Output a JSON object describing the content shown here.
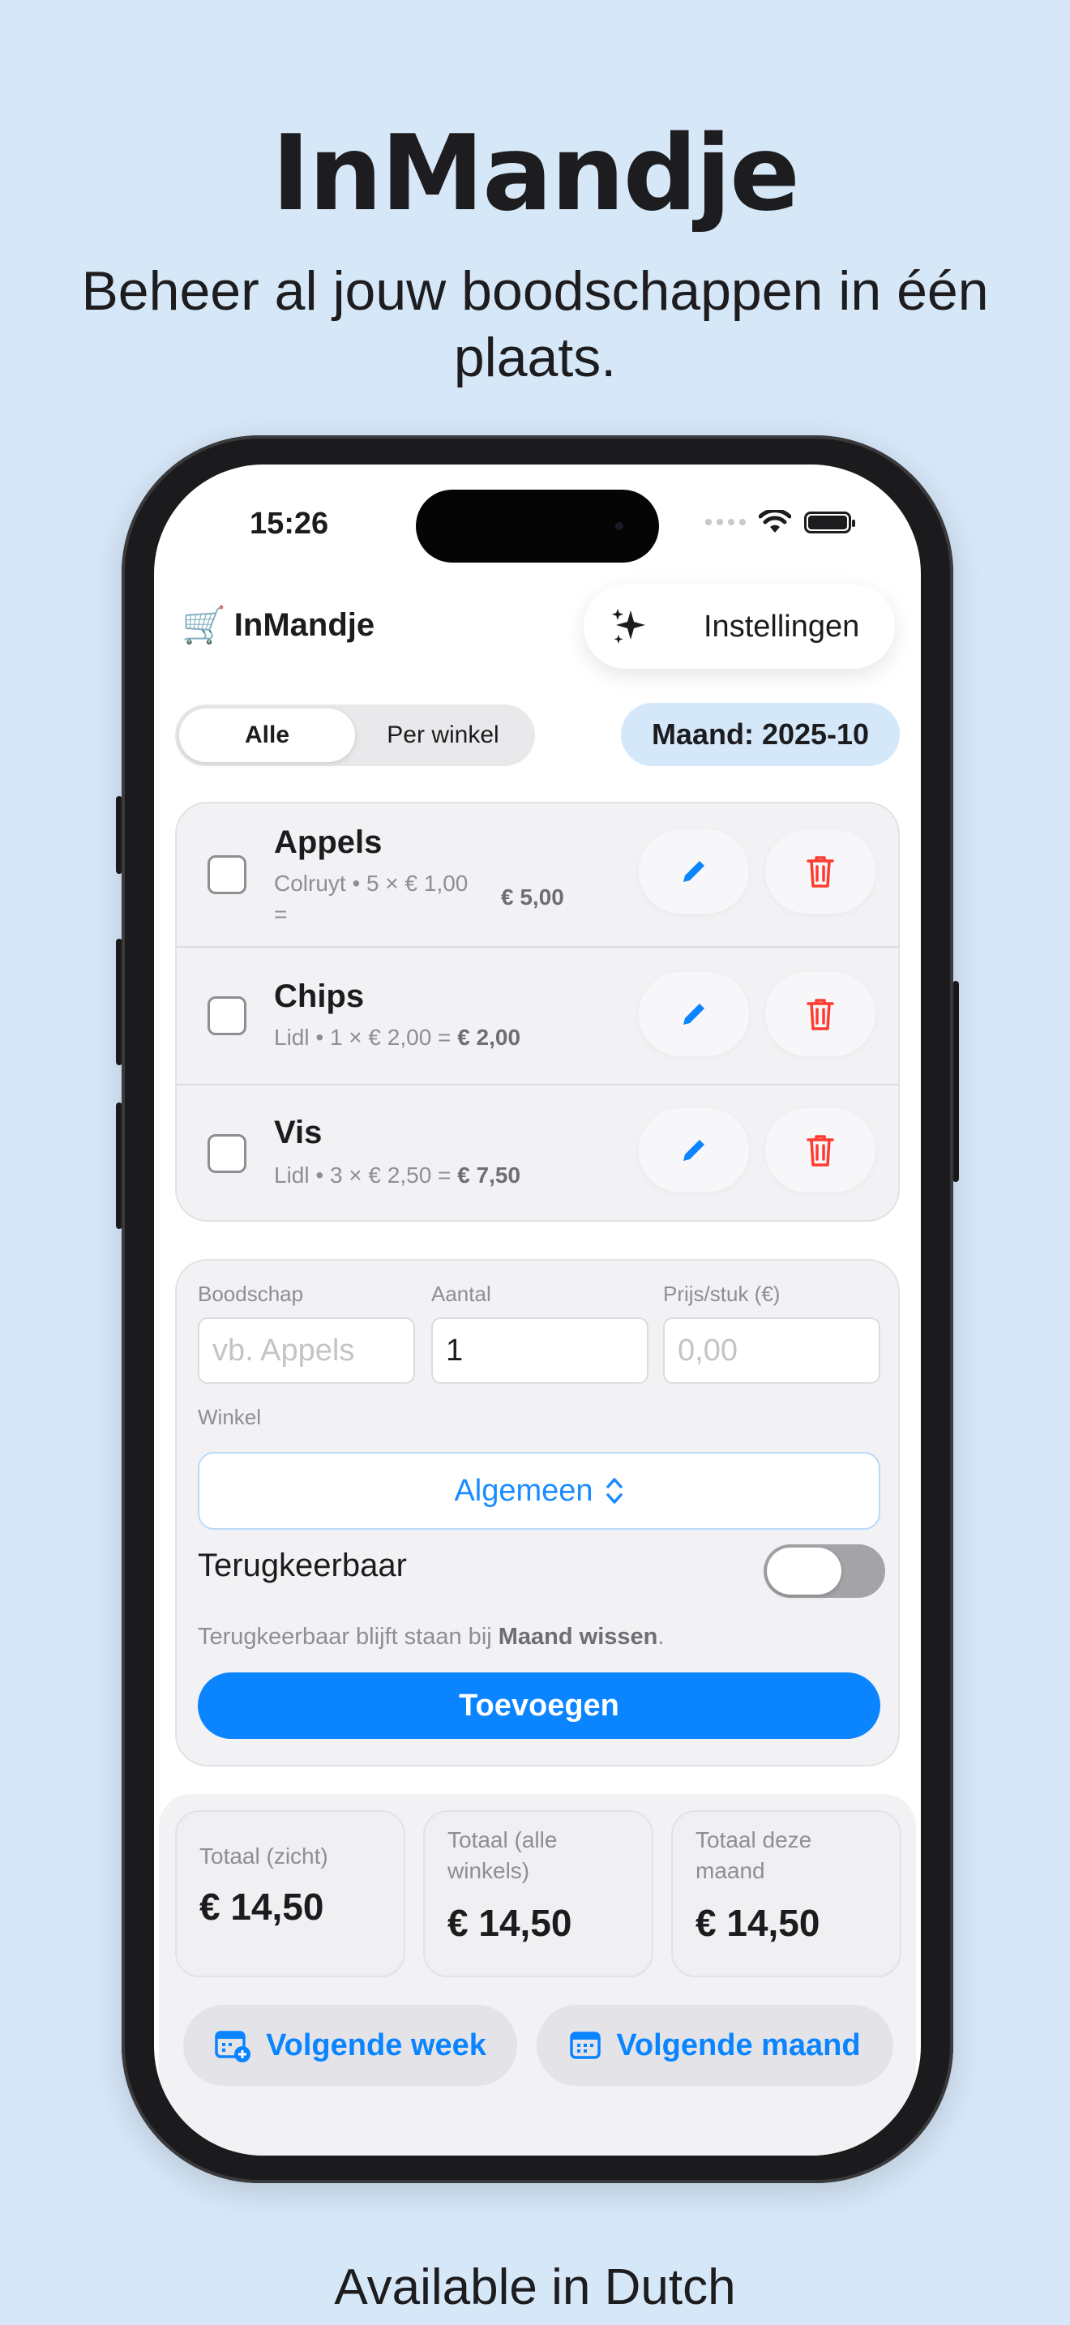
{
  "promo": {
    "title": "InMandje",
    "subtitle": "Beheer al jouw boodschappen in één plaats.",
    "footer": "Available in Dutch"
  },
  "status_bar": {
    "time": "15:26"
  },
  "header": {
    "cart_icon": "🛒",
    "app_name": "InMandje",
    "settings_label": "Instellingen"
  },
  "filter": {
    "segments": [
      "Alle",
      "Per winkel"
    ],
    "active": "Alle",
    "month_label": "Maand: 2025-10"
  },
  "items": [
    {
      "name": "Appels",
      "sub": "Colruyt • 5 × € 1,00",
      "sub2": "=",
      "total": "€ 5,00"
    },
    {
      "name": "Chips",
      "sub": "Lidl • 1 × € 2,00 = ",
      "total": "€ 2,00"
    },
    {
      "name": "Vis",
      "sub": "Lidl • 3 × € 2,50 = ",
      "total": "€ 7,50"
    }
  ],
  "form": {
    "item_label": "Boodschap",
    "item_placeholder": "vb. Appels",
    "qty_label": "Aantal",
    "qty_value": "1",
    "price_label": "Prijs/stuk (€)",
    "price_placeholder": "0,00",
    "shop_label": "Winkel",
    "shop_value": "Algemeen",
    "toggle_label": "Terugkeerbaar",
    "toggle_on": false,
    "hint_prefix": "Terugkeerbaar blijft staan bij ",
    "hint_bold": "Maand wissen",
    "hint_suffix": ".",
    "add_label": "Toevoegen"
  },
  "totals": [
    {
      "label": "Totaal (zicht)",
      "value": "€ 14,50"
    },
    {
      "label": "Totaal (alle winkels)",
      "value": "€ 14,50"
    },
    {
      "label": "Totaal deze maand",
      "value": "€ 14,50"
    }
  ],
  "actions": {
    "next_week": "Volgende week",
    "next_month": "Volgende maand"
  },
  "colors": {
    "background": "#d6e7f8",
    "accent": "#0a84ff",
    "delete": "#ff3b30",
    "badge": "#d4e8fa"
  }
}
